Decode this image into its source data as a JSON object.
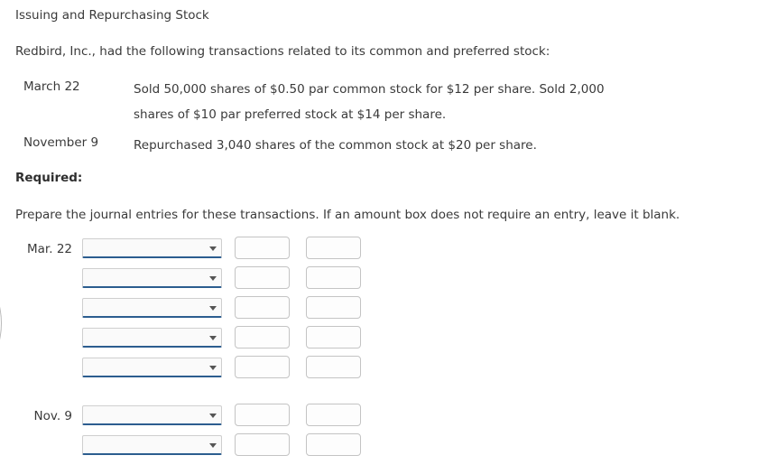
{
  "document": {
    "title": "Issuing and Repurchasing Stock",
    "intro": "Redbird, Inc., had the following transactions related to its common and preferred stock:",
    "transactions": [
      {
        "date": "March 22",
        "lines": [
          "Sold 50,000 shares of $0.50 par common stock for $12 per share. Sold 2,000",
          "shares of $10 par preferred stock at $14 per share."
        ]
      },
      {
        "date": "November 9",
        "lines": [
          "Repurchased 3,040 shares of the common stock at $20 per share."
        ]
      }
    ],
    "required_heading": "Required:",
    "instruction": "Prepare the journal entries for these transactions. If an amount box does not require an entry, leave it blank."
  },
  "journal": {
    "select_placeholder": "",
    "amount_placeholder": "",
    "groups": [
      {
        "label": "Mar. 22",
        "rows": [
          {
            "account": "",
            "debit": "",
            "credit": ""
          },
          {
            "account": "",
            "debit": "",
            "credit": ""
          },
          {
            "account": "",
            "debit": "",
            "credit": ""
          },
          {
            "account": "",
            "debit": "",
            "credit": ""
          },
          {
            "account": "",
            "debit": "",
            "credit": ""
          }
        ]
      },
      {
        "label": "Nov. 9",
        "rows": [
          {
            "account": "",
            "debit": "",
            "credit": ""
          },
          {
            "account": "",
            "debit": "",
            "credit": ""
          }
        ]
      }
    ]
  },
  "colors": {
    "text": "#3a3a3a",
    "select_underline": "#2c5d8f",
    "box_border": "#c4c4c4",
    "arc_border": "#b9b9b9"
  }
}
